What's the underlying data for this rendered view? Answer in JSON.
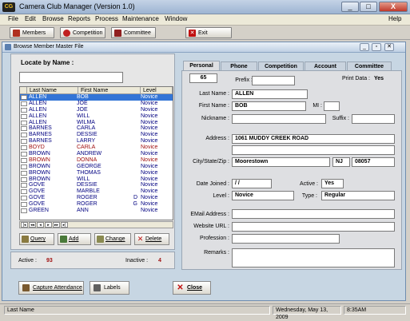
{
  "window": {
    "title": "Camera Club Manager (Version 1.0)",
    "icon_text": "CG",
    "minimize": "_",
    "maximize": "□",
    "close": "X"
  },
  "menu": [
    "File",
    "Edit",
    "Browse",
    "Reports",
    "Process",
    "Maintenance",
    "Window",
    "Help"
  ],
  "toolbar": [
    {
      "label": "Members",
      "icon": "members-icon",
      "color": "#b03020"
    },
    {
      "label": "Competition",
      "icon": "competition-icon",
      "color": "#c02020"
    },
    {
      "label": "Committee",
      "icon": "committee-icon",
      "color": "#902020"
    },
    {
      "label": "Exit",
      "icon": "exit-icon",
      "color": "#c01010"
    }
  ],
  "child_window": {
    "title": "Browse Member Master File"
  },
  "locate": {
    "label": "Locate by Name :",
    "value": ""
  },
  "grid": {
    "headers": [
      "Last Name",
      "First Name",
      "",
      "Level"
    ],
    "rows": [
      {
        "last": "ALLEN",
        "first": "BOB",
        "mi": "",
        "level": "Novice",
        "selected": true,
        "color": "#000080"
      },
      {
        "last": "ALLEN",
        "first": "JOE",
        "mi": "",
        "level": "Novice",
        "color": "#000080"
      },
      {
        "last": "ALLEN",
        "first": "JOE",
        "mi": "",
        "level": "Novice",
        "color": "#000080"
      },
      {
        "last": "ALLEN",
        "first": "WILL",
        "mi": "",
        "level": "Novice",
        "color": "#000080"
      },
      {
        "last": "ALLEN",
        "first": "WILMA",
        "mi": "",
        "level": "Novice",
        "color": "#000080"
      },
      {
        "last": "BARNES",
        "first": "CARLA",
        "mi": "",
        "level": "Novice",
        "color": "#000080"
      },
      {
        "last": "BARNES",
        "first": "DESSIE",
        "mi": "",
        "level": "Novice",
        "color": "#000080"
      },
      {
        "last": "BARNES",
        "first": "LARRY",
        "mi": "",
        "level": "Novice",
        "color": "#000080"
      },
      {
        "last": "BOYD",
        "first": "CARLA",
        "mi": "",
        "level": "Novice",
        "color": "#a01010"
      },
      {
        "last": "BROWN",
        "first": "ANDREW",
        "mi": "",
        "level": "Novice",
        "color": "#000080"
      },
      {
        "last": "BROWN",
        "first": "DONNA",
        "mi": "",
        "level": "Novice",
        "color": "#a01010"
      },
      {
        "last": "BROWN",
        "first": "GEORGE",
        "mi": "",
        "level": "Novice",
        "color": "#000080"
      },
      {
        "last": "BROWN",
        "first": "THOMAS",
        "mi": "",
        "level": "Novice",
        "color": "#000080"
      },
      {
        "last": "BROWN",
        "first": "WILL",
        "mi": "",
        "level": "Novice",
        "color": "#000080"
      },
      {
        "last": "GOVE",
        "first": "DESSIE",
        "mi": "",
        "level": "Novice",
        "color": "#000080"
      },
      {
        "last": "GOVE",
        "first": "MARBLE",
        "mi": "",
        "level": "Novice",
        "color": "#000080"
      },
      {
        "last": "GOVE",
        "first": "ROGER",
        "mi": "D",
        "level": "Novice",
        "color": "#000080"
      },
      {
        "last": "GOVE",
        "first": "ROGER",
        "mi": "G",
        "level": "Novice",
        "color": "#000080"
      },
      {
        "last": "GREEN",
        "first": "ANN",
        "mi": "",
        "level": "Novice",
        "color": "#000080"
      }
    ]
  },
  "nav_buttons": [
    "|◂",
    "◂◂",
    "◂",
    "▸",
    "▸▸",
    "▸|"
  ],
  "actions": [
    {
      "label": "Query",
      "icon": "query-icon"
    },
    {
      "label": "Add",
      "icon": "add-icon"
    },
    {
      "label": "Change",
      "icon": "change-icon"
    },
    {
      "label": "Delete",
      "icon": "delete-icon"
    }
  ],
  "counts": {
    "active_label": "Active :",
    "active": "93",
    "inactive_label": "Inactive :",
    "inactive": "4"
  },
  "tabs": [
    "Personal",
    "Phone",
    "Competition",
    "Account",
    "Committee"
  ],
  "member": {
    "id": "65",
    "prefix_label": "Prefix :",
    "prefix": "",
    "print_data_label": "Print Data :",
    "print_data": "Yes",
    "last_name_label": "Last Name :",
    "last_name": "ALLEN",
    "first_name_label": "First Name :",
    "first_name": "BOB",
    "mi_label": "MI :",
    "mi": "",
    "nickname_label": "Nickname :",
    "nickname": "",
    "suffix_label": "Suffix :",
    "suffix": "",
    "address_label": "Address :",
    "address1": "1061 MUDDY CREEK ROAD",
    "address2": "",
    "csz_label": "City/State/Zip :",
    "city": "Moorestown",
    "state": "NJ",
    "zip": "08057",
    "date_joined_label": "Date Joined :",
    "date_joined": " /  /",
    "active_label": "Active :",
    "active": "Yes",
    "level_label": "Level :",
    "level": "Novice",
    "type_label": "Type :",
    "type": "Regular",
    "email_label": "EMail Address :",
    "email": "",
    "website_label": "Website URL :",
    "website": "",
    "profession_label": "Profession :",
    "profession": "",
    "remarks_label": "Remarks :",
    "remarks": ""
  },
  "bottom_buttons": [
    {
      "label": "Capture Attendance",
      "icon": "attendance-icon"
    },
    {
      "label": "Labels",
      "icon": "printer-icon"
    },
    {
      "label": "Close",
      "icon": "close-x-icon"
    }
  ],
  "statusbar": {
    "field": "Last Name",
    "date": "Wednesday, May 13, 2009",
    "time": "8:35AM"
  }
}
